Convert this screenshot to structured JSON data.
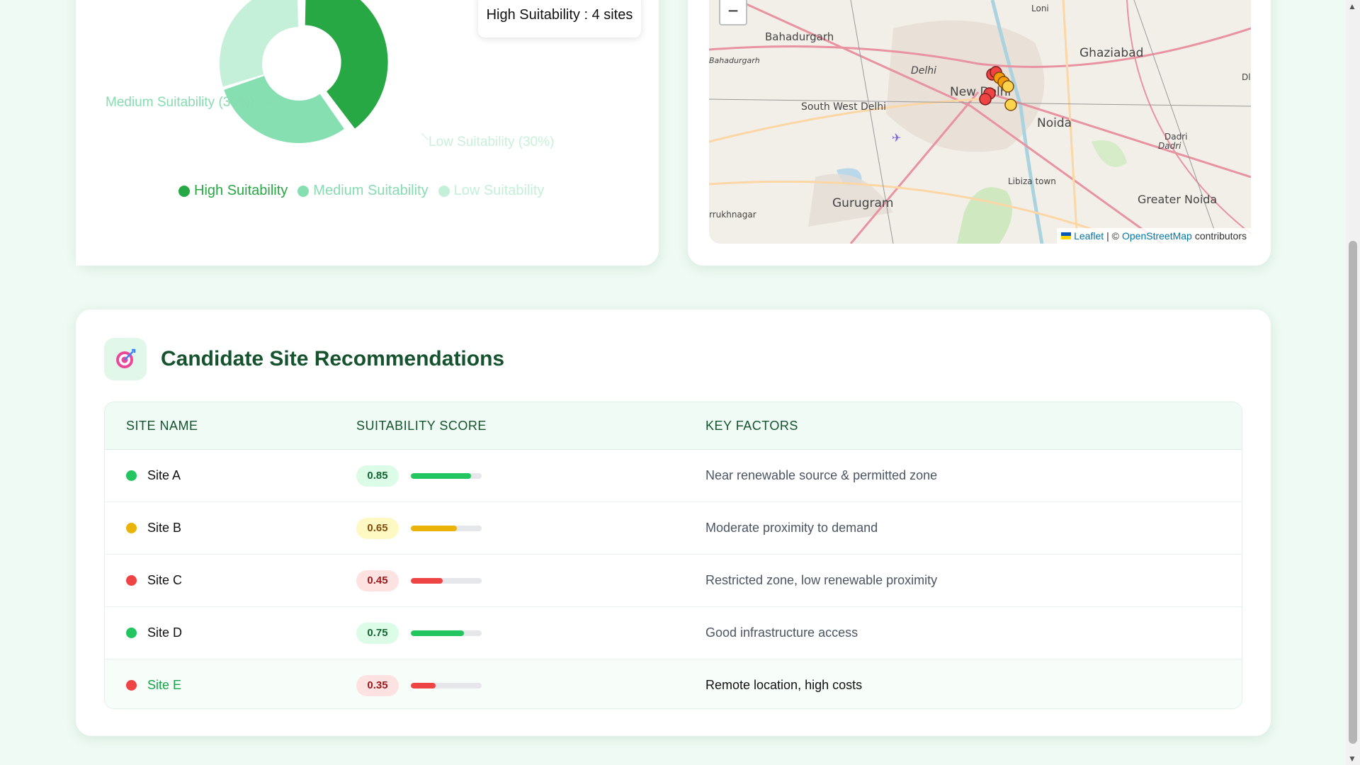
{
  "pie": {
    "tooltip": "High Suitability : 4 sites",
    "slice_labels": {
      "medium": "Medium Suitability (30%)",
      "low": "Low Suitability (30%)"
    },
    "legend": [
      "High Suitability",
      "Medium Suitability",
      "Low Suitability"
    ],
    "colors": {
      "high": "#27a844",
      "medium": "#86dfb0",
      "low": "#c4f0d9"
    }
  },
  "chart_data": {
    "type": "pie",
    "categories": [
      "High Suitability",
      "Medium Suitability",
      "Low Suitability"
    ],
    "values": [
      40,
      30,
      30
    ],
    "legend_position": "bottom"
  },
  "map": {
    "zoom_out": "−",
    "places": [
      "Loni",
      "Ghaziabad",
      "Bahadurgarh",
      "Bahadurgarh",
      "Delhi",
      "New Delhi",
      "South West Delhi",
      "Noida",
      "Dadri",
      "Dadri",
      "Libiza town",
      "Gurugram",
      "Greater Noida",
      "rrukhnagar",
      "Dl"
    ],
    "attribution": {
      "leaflet": "Leaflet",
      "sep": "| ©",
      "osm": "OpenStreetMap",
      "suffix": "contributors"
    }
  },
  "recommendations": {
    "title": "Candidate Site Recommendations",
    "icon": "target-icon",
    "columns": [
      "SITE NAME",
      "SUITABILITY SCORE",
      "KEY FACTORS"
    ],
    "rows": [
      {
        "name": "Site A",
        "score": "0.85",
        "factors": "Near renewable source & permitted zone"
      },
      {
        "name": "Site B",
        "score": "0.65",
        "factors": "Moderate proximity to demand"
      },
      {
        "name": "Site C",
        "score": "0.45",
        "factors": "Restricted zone, low renewable proximity"
      },
      {
        "name": "Site D",
        "score": "0.75",
        "factors": "Good infrastructure access"
      },
      {
        "name": "Site E",
        "score": "0.35",
        "factors": "Remote location, high costs"
      }
    ],
    "status_colors": {
      "green": "#22c55e",
      "yellow": "#eab308",
      "red": "#ef4444"
    }
  }
}
